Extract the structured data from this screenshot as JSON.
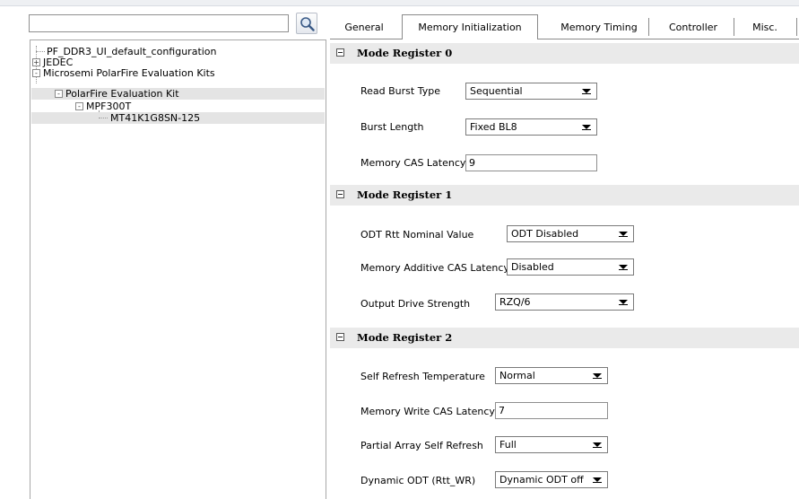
{
  "search": {
    "value": ""
  },
  "tree": {
    "root": "PF_DDR3_UI_default_configuration",
    "jedec": "JEDEC",
    "microsemi": "Microsemi PolarFire Evaluation Kits",
    "kit": "PolarFire Evaluation Kit",
    "device": "MPF300T",
    "part": "MT41K1G8SN-125",
    "expand_plus": "+",
    "expand_minus": "-"
  },
  "tabs": [
    "General",
    "Memory Initialization",
    "Memory Timing",
    "Controller",
    "Misc."
  ],
  "active_tab": "Memory Initialization",
  "sections": {
    "mr0": {
      "title": "Mode Register 0",
      "read_burst_type": {
        "label": "Read Burst Type",
        "value": "Sequential"
      },
      "burst_length": {
        "label": "Burst Length",
        "value": "Fixed BL8"
      },
      "cas_latency": {
        "label": "Memory CAS Latency",
        "value": "9"
      }
    },
    "mr1": {
      "title": "Mode Register 1",
      "odt_rtt": {
        "label": "ODT Rtt Nominal Value",
        "value": "ODT Disabled"
      },
      "additive_cas": {
        "label": "Memory Additive CAS Latency",
        "value": "Disabled"
      },
      "drive_strength": {
        "label": "Output Drive Strength",
        "value": "RZQ/6"
      }
    },
    "mr2": {
      "title": "Mode Register 2",
      "self_refresh_temp": {
        "label": "Self Refresh Temperature",
        "value": "Normal"
      },
      "write_cas": {
        "label": "Memory Write CAS Latency",
        "value": "7"
      },
      "partial_array": {
        "label": "Partial Array Self Refresh",
        "value": "Full"
      },
      "dynamic_odt": {
        "label": "Dynamic ODT (Rtt_WR)",
        "value": "Dynamic ODT off"
      }
    }
  },
  "colors": {
    "section_bg": "#eaeaea",
    "selected_row": "#e4e4e4",
    "border": "#8a8a8a"
  }
}
